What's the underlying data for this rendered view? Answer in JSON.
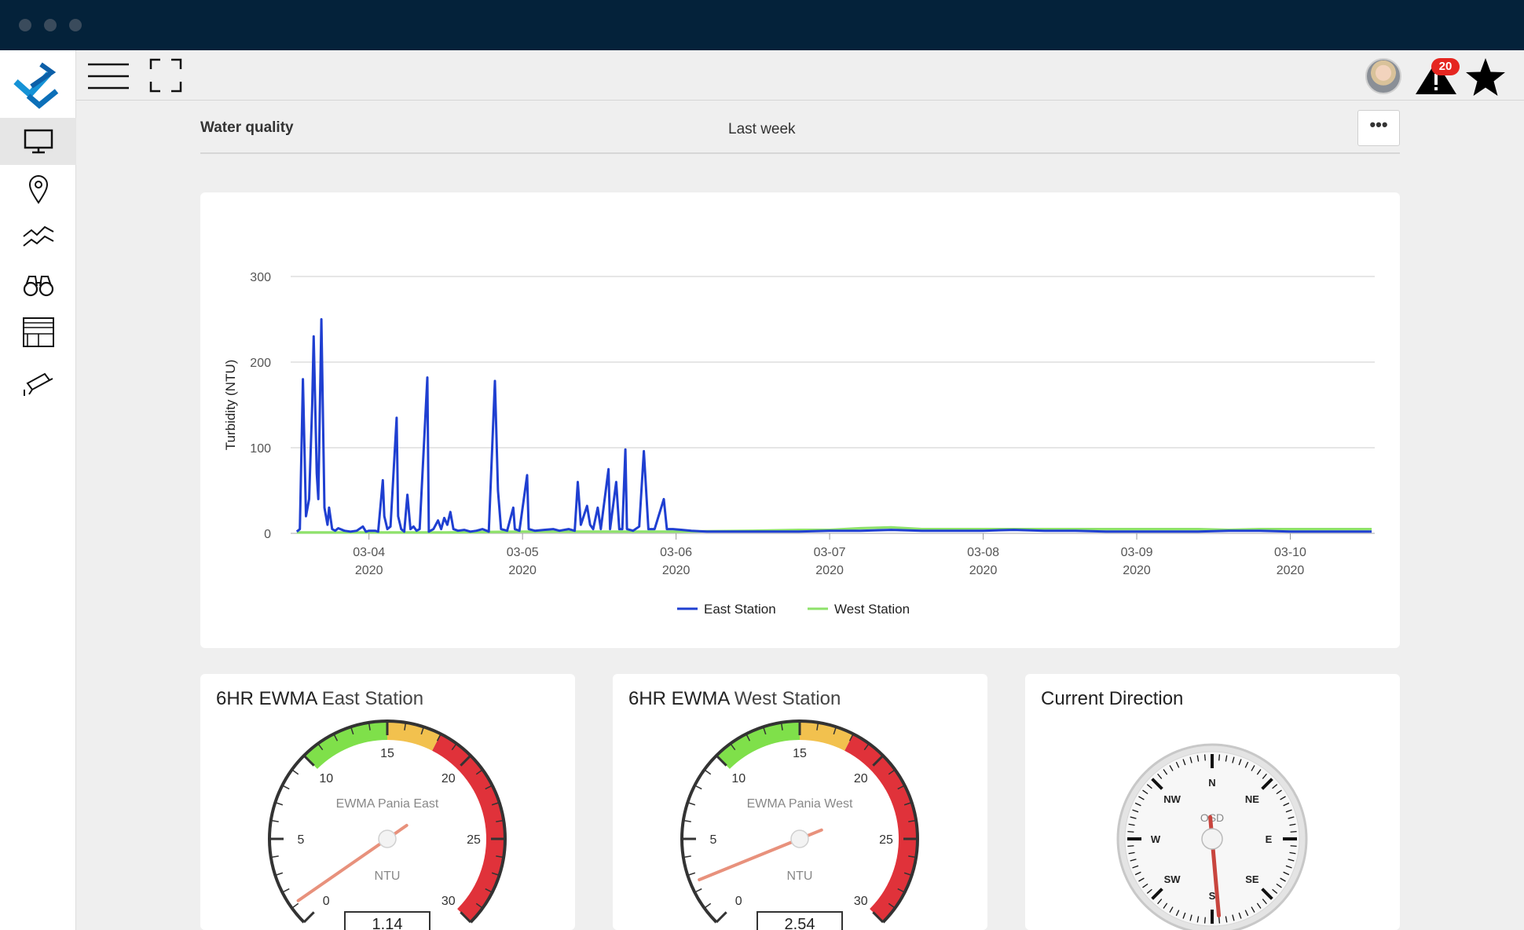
{
  "window": {
    "dots": [
      "close",
      "minimize",
      "maximize"
    ]
  },
  "sidebar": {
    "items": [
      {
        "name": "monitor",
        "icon": "monitor-icon",
        "active": true
      },
      {
        "name": "location",
        "icon": "map-pin-icon",
        "active": false
      },
      {
        "name": "trends",
        "icon": "trend-lines-icon",
        "active": false
      },
      {
        "name": "explore",
        "icon": "binoculars-icon",
        "active": false
      },
      {
        "name": "layout",
        "icon": "layout-grid-icon",
        "active": false
      },
      {
        "name": "camera",
        "icon": "security-camera-icon",
        "active": false
      }
    ]
  },
  "topbar": {
    "notifications_count": "20"
  },
  "header": {
    "title": "Water quality",
    "period": "Last week",
    "more_label": "•••"
  },
  "chart_data": {
    "type": "line",
    "ylabel": "Turbidity (NTU)",
    "ylim": [
      0,
      300
    ],
    "yticks": [
      "0",
      "100",
      "200",
      "300"
    ],
    "x_ticks": [
      {
        "day": "03-04",
        "year": "2020"
      },
      {
        "day": "03-05",
        "year": "2020"
      },
      {
        "day": "03-06",
        "year": "2020"
      },
      {
        "day": "03-07",
        "year": "2020"
      },
      {
        "day": "03-08",
        "year": "2020"
      },
      {
        "day": "03-09",
        "year": "2020"
      },
      {
        "day": "03-10",
        "year": "2020"
      }
    ],
    "x_range": [
      3.49,
      10.55
    ],
    "grid": true,
    "legend": "bottom-center",
    "series": [
      {
        "name": "East Station",
        "color": "#1f3fd1",
        "points": [
          [
            3.53,
            2
          ],
          [
            3.55,
            5
          ],
          [
            3.57,
            180
          ],
          [
            3.59,
            20
          ],
          [
            3.61,
            40
          ],
          [
            3.63,
            150
          ],
          [
            3.64,
            230
          ],
          [
            3.66,
            70
          ],
          [
            3.67,
            40
          ],
          [
            3.69,
            250
          ],
          [
            3.71,
            30
          ],
          [
            3.73,
            10
          ],
          [
            3.74,
            30
          ],
          [
            3.76,
            5
          ],
          [
            3.78,
            3
          ],
          [
            3.8,
            6
          ],
          [
            3.84,
            3
          ],
          [
            3.88,
            2
          ],
          [
            3.92,
            3
          ],
          [
            3.96,
            8
          ],
          [
            3.98,
            2
          ],
          [
            4.0,
            3
          ],
          [
            4.04,
            3
          ],
          [
            4.06,
            2
          ],
          [
            4.09,
            62
          ],
          [
            4.1,
            20
          ],
          [
            4.12,
            5
          ],
          [
            4.14,
            8
          ],
          [
            4.18,
            135
          ],
          [
            4.19,
            20
          ],
          [
            4.21,
            5
          ],
          [
            4.23,
            2
          ],
          [
            4.25,
            45
          ],
          [
            4.27,
            5
          ],
          [
            4.29,
            8
          ],
          [
            4.31,
            3
          ],
          [
            4.33,
            5
          ],
          [
            4.38,
            182
          ],
          [
            4.39,
            2
          ],
          [
            4.42,
            5
          ],
          [
            4.45,
            15
          ],
          [
            4.47,
            5
          ],
          [
            4.49,
            18
          ],
          [
            4.51,
            10
          ],
          [
            4.53,
            25
          ],
          [
            4.55,
            5
          ],
          [
            4.58,
            3
          ],
          [
            4.62,
            4
          ],
          [
            4.66,
            2
          ],
          [
            4.7,
            3
          ],
          [
            4.74,
            5
          ],
          [
            4.78,
            2
          ],
          [
            4.82,
            178
          ],
          [
            4.84,
            50
          ],
          [
            4.86,
            5
          ],
          [
            4.9,
            3
          ],
          [
            4.94,
            30
          ],
          [
            4.95,
            5
          ],
          [
            4.98,
            3
          ],
          [
            5.03,
            68
          ],
          [
            5.04,
            5
          ],
          [
            5.08,
            3
          ],
          [
            5.14,
            4
          ],
          [
            5.2,
            5
          ],
          [
            5.24,
            3
          ],
          [
            5.3,
            5
          ],
          [
            5.34,
            3
          ],
          [
            5.36,
            60
          ],
          [
            5.38,
            10
          ],
          [
            5.42,
            32
          ],
          [
            5.44,
            10
          ],
          [
            5.46,
            5
          ],
          [
            5.49,
            30
          ],
          [
            5.51,
            5
          ],
          [
            5.56,
            75
          ],
          [
            5.57,
            5
          ],
          [
            5.61,
            60
          ],
          [
            5.63,
            5
          ],
          [
            5.65,
            5
          ],
          [
            5.67,
            98
          ],
          [
            5.68,
            5
          ],
          [
            5.72,
            3
          ],
          [
            5.76,
            8
          ],
          [
            5.79,
            96
          ],
          [
            5.82,
            5
          ],
          [
            5.86,
            5
          ],
          [
            5.92,
            40
          ],
          [
            5.94,
            5
          ],
          [
            5.98,
            5
          ],
          [
            6.04,
            4
          ],
          [
            6.1,
            3
          ],
          [
            6.2,
            2
          ],
          [
            6.4,
            2
          ],
          [
            6.6,
            2
          ],
          [
            6.8,
            2
          ],
          [
            7.0,
            3
          ],
          [
            7.2,
            3
          ],
          [
            7.4,
            4
          ],
          [
            7.6,
            3
          ],
          [
            7.8,
            3
          ],
          [
            8.0,
            3
          ],
          [
            8.2,
            4
          ],
          [
            8.4,
            3
          ],
          [
            8.6,
            3
          ],
          [
            8.8,
            2
          ],
          [
            9.0,
            2
          ],
          [
            9.2,
            2
          ],
          [
            9.4,
            2
          ],
          [
            9.6,
            3
          ],
          [
            9.8,
            3
          ],
          [
            10.0,
            2
          ],
          [
            10.2,
            2
          ],
          [
            10.4,
            2
          ],
          [
            10.53,
            2
          ]
        ]
      },
      {
        "name": "West Station",
        "color": "#8ee26a",
        "points": [
          [
            3.53,
            1
          ],
          [
            4.0,
            1
          ],
          [
            4.5,
            1
          ],
          [
            5.0,
            2
          ],
          [
            5.5,
            2
          ],
          [
            6.0,
            2
          ],
          [
            6.5,
            3
          ],
          [
            6.8,
            4
          ],
          [
            7.0,
            4
          ],
          [
            7.2,
            6
          ],
          [
            7.4,
            7
          ],
          [
            7.6,
            5
          ],
          [
            7.8,
            5
          ],
          [
            8.0,
            5
          ],
          [
            8.2,
            5
          ],
          [
            8.4,
            5
          ],
          [
            8.6,
            5
          ],
          [
            8.8,
            5
          ],
          [
            9.0,
            5
          ],
          [
            9.2,
            5
          ],
          [
            9.4,
            5
          ],
          [
            9.6,
            4
          ],
          [
            9.8,
            5
          ],
          [
            10.0,
            5
          ],
          [
            10.2,
            5
          ],
          [
            10.4,
            5
          ],
          [
            10.53,
            5
          ]
        ]
      }
    ]
  },
  "gauges": [
    {
      "title_bold": "6HR EWMA",
      "title_light": "East Station",
      "inner_label": "EWMA Pania East",
      "unit": "NTU",
      "value": 1.14,
      "value_text": "1.14",
      "min": 0,
      "max": 30,
      "ticks": [
        "0",
        "5",
        "10",
        "15",
        "20",
        "25",
        "30"
      ],
      "bands": [
        {
          "from": 10,
          "to": 15,
          "color": "#7fe04a"
        },
        {
          "from": 15,
          "to": 18,
          "color": "#f2c14e"
        },
        {
          "from": 18,
          "to": 30,
          "color": "#e0323a"
        }
      ]
    },
    {
      "title_bold": "6HR EWMA",
      "title_light": "West Station",
      "inner_label": "EWMA Pania West",
      "unit": "NTU",
      "value": 2.54,
      "value_text": "2.54",
      "min": 0,
      "max": 30,
      "ticks": [
        "0",
        "5",
        "10",
        "15",
        "20",
        "25",
        "30"
      ],
      "bands": [
        {
          "from": 10,
          "to": 15,
          "color": "#7fe04a"
        },
        {
          "from": 15,
          "to": 18,
          "color": "#f2c14e"
        },
        {
          "from": 18,
          "to": 30,
          "color": "#e0323a"
        }
      ]
    }
  ],
  "compass": {
    "title": "Current Direction",
    "inner_label": "OSD",
    "labels": [
      "N",
      "NE",
      "E",
      "SE",
      "S",
      "SW",
      "W",
      "NW"
    ],
    "heading_deg": 175
  }
}
